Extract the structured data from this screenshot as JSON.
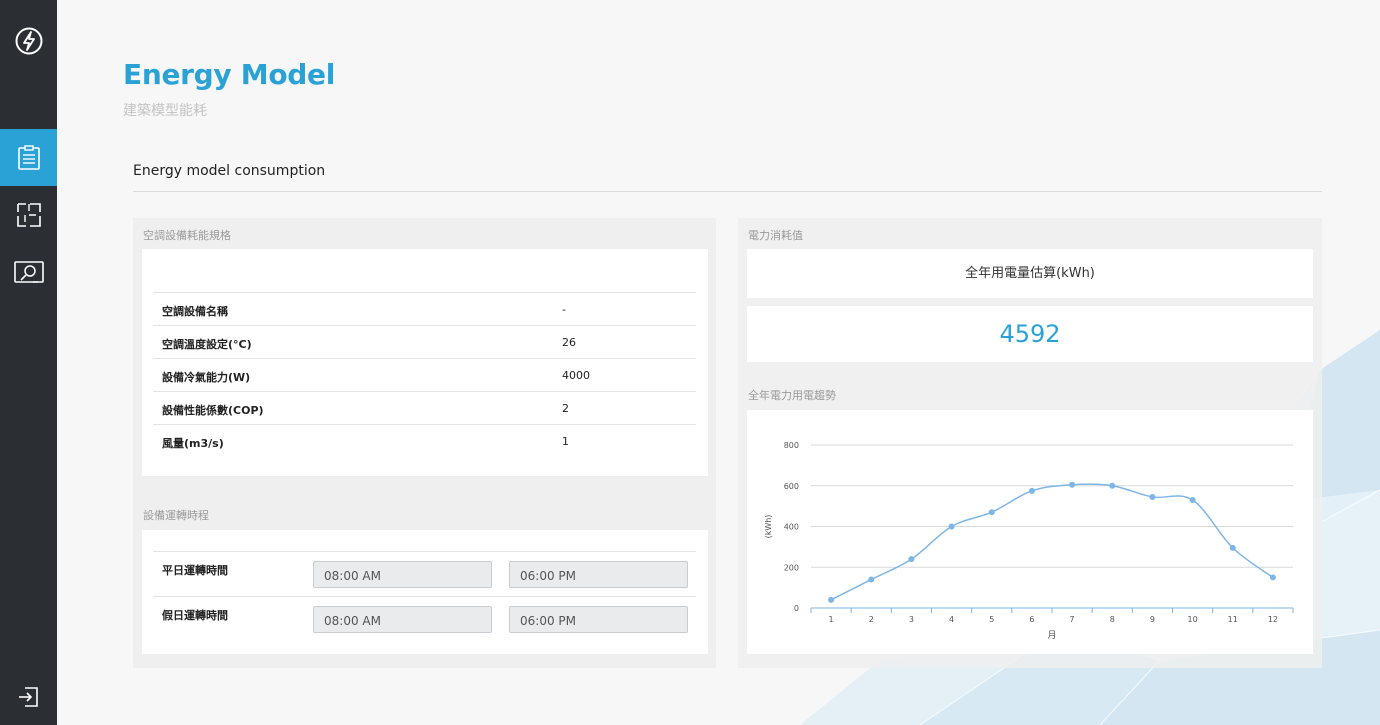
{
  "header": {
    "title": "Energy Model",
    "subtitle": "建築模型能耗",
    "section_title": "Energy model consumption"
  },
  "sidebar": {
    "items": [
      {
        "icon": "lightning-logo-icon"
      },
      {
        "icon": "clipboard-list-icon",
        "active": true
      },
      {
        "icon": "floorplan-icon"
      },
      {
        "icon": "monitor-search-icon"
      },
      {
        "icon": "logout-icon"
      }
    ]
  },
  "ac_spec": {
    "label": "空調設備耗能規格",
    "rows": [
      {
        "key": "空調設備名稱",
        "value": "-"
      },
      {
        "key": "空調溫度設定(°C)",
        "value": "26"
      },
      {
        "key": "設備冷氣能力(W)",
        "value": "4000"
      },
      {
        "key": "設備性能係數(COP)",
        "value": "2"
      },
      {
        "key": "風量(m3/s)",
        "value": "1"
      }
    ]
  },
  "schedule": {
    "label": "設備運轉時程",
    "rows": [
      {
        "key": "平日運轉時間",
        "start": "08:00 AM",
        "end": "06:00 PM"
      },
      {
        "key": "假日運轉時間",
        "start": "08:00 AM",
        "end": "06:00 PM"
      }
    ]
  },
  "energy": {
    "label": "電力消耗值",
    "annual_title": "全年用電量估算(kWh)",
    "annual_value": "4592",
    "trend_label": "全年電力用電趨勢"
  },
  "colors": {
    "accent": "#2aa2d6",
    "sidebar": "#2b2e33",
    "line": "#7db6e6"
  },
  "chart_data": {
    "type": "line",
    "categories": [
      "1",
      "2",
      "3",
      "4",
      "5",
      "6",
      "7",
      "8",
      "9",
      "10",
      "11",
      "12"
    ],
    "series": [
      {
        "values": [
          40,
          140,
          240,
          400,
          470,
          575,
          605,
          600,
          545,
          530,
          295,
          150
        ]
      }
    ],
    "xlabel": "月",
    "ylabel": "(kWh)",
    "ylim": [
      0,
      800
    ],
    "yticks": [
      "0",
      "200",
      "400",
      "600",
      "800"
    ],
    "grid": true,
    "legend": "none"
  }
}
